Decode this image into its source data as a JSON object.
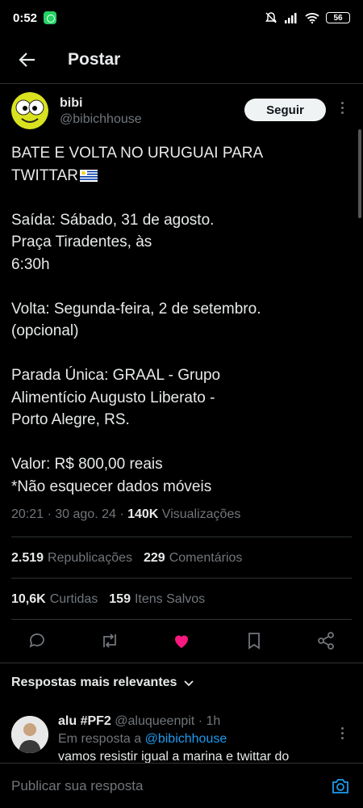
{
  "status_bar": {
    "time": "0:52",
    "battery": "56"
  },
  "header": {
    "title": "Postar"
  },
  "post": {
    "author_name": "bibi",
    "author_handle": "@bibichhouse",
    "follow_label": "Seguir",
    "text": "BATE E VOLTA NO URUGUAI PARA\nTWITTAR",
    "text_rest": "\n\nSaída: Sábado, 31 de agosto.\nPraça Tiradentes, às\n6:30h\n\nVolta: Segunda-feira, 2 de setembro.\n(opcional)\n\nParada Única: GRAAL - Grupo\nAlimentício Augusto Liberato -\nPorto Alegre, RS.\n\nValor: R$ 800,00 reais\n*Não esquecer dados móveis",
    "timestamp": "20:21 · 30 ago. 24 · ",
    "views_count": "140K",
    "views_label": " Visualizações",
    "reposts_count": "2.519",
    "reposts_label": "Republicações",
    "comments_count": "229",
    "comments_label": "Comentários",
    "likes_count": "10,6K",
    "likes_label": "Curtidas",
    "saves_count": "159",
    "saves_label": "Itens Salvos"
  },
  "actions": [
    "reply-icon",
    "repost-icon",
    "like-icon",
    "bookmark-icon",
    "share-icon"
  ],
  "colors": {
    "like": "#f91880",
    "link": "#1d9bf0",
    "flag_blue": "#0038a8"
  },
  "replies_sort": {
    "label": "Respostas mais relevantes"
  },
  "reply": {
    "name": "alu #PF2",
    "handle": "@aluqueenpit",
    "time": " · 1h",
    "in_reply_prefix": "Em resposta a ",
    "in_reply_handle": "@bibichhouse",
    "text": "vamos resistir igual a marina e twittar do"
  },
  "composer": {
    "placeholder": "Publicar sua resposta"
  }
}
